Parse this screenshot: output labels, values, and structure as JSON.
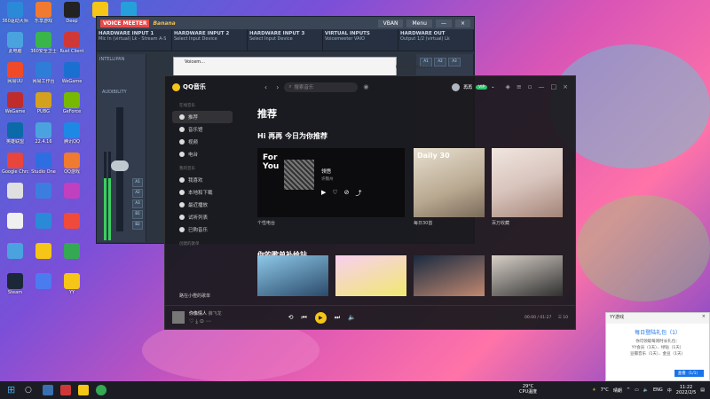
{
  "desktop_icons": [
    {
      "label": "360驱动大师",
      "color": "#2b8ad8"
    },
    {
      "label": "乐享游戏",
      "color": "#f07a30"
    },
    {
      "label": "Deep",
      "color": "#222"
    },
    {
      "label": "",
      "color": "#f5c518"
    },
    {
      "label": "",
      "color": "#26a0da"
    },
    {
      "label": "此电脑",
      "color": "#4aa3df"
    },
    {
      "label": "360安全卫士",
      "color": "#3ab54a"
    },
    {
      "label": "Rust Client",
      "color": "#d03838"
    },
    {
      "label": "网易UU",
      "color": "#f04a28"
    },
    {
      "label": "网易工作台",
      "color": "#2e7dd6"
    },
    {
      "label": "WeGame",
      "color": "#1b6fd0"
    },
    {
      "label": "WeGame",
      "color": "#c02b2b"
    },
    {
      "label": "PUBG",
      "color": "#d4a020"
    },
    {
      "label": "GeForce",
      "color": "#76b900"
    },
    {
      "label": "英雄联盟",
      "color": "#0b6aa8"
    },
    {
      "label": "22.4.16",
      "color": "#4aa3df"
    },
    {
      "label": "腾讯QQ",
      "color": "#1e88e5"
    },
    {
      "label": "Google Chrome",
      "color": "#e8453c"
    },
    {
      "label": "Studio One",
      "color": "#2d6fe0"
    },
    {
      "label": "QQ游戏",
      "color": "#f07a30"
    },
    {
      "label": "",
      "color": "#e0e0e0"
    },
    {
      "label": "",
      "color": "#3b7ee0"
    },
    {
      "label": "",
      "color": "#c040c0"
    },
    {
      "label": "",
      "color": "#f0f0f0"
    },
    {
      "label": "",
      "color": "#2b8ad8"
    },
    {
      "label": "",
      "color": "#f04a3a"
    },
    {
      "label": "",
      "color": "#4aa3df"
    },
    {
      "label": "",
      "color": "#f5c518"
    },
    {
      "label": "",
      "color": "#34a853"
    },
    {
      "label": "Steam",
      "color": "#1b2838"
    },
    {
      "label": "",
      "color": "#4a7cf0"
    },
    {
      "label": "YY",
      "color": "#f5c518"
    }
  ],
  "voicemeeter": {
    "brand": "VOICE MEETER",
    "brand2": "Banana",
    "buttons": [
      "VBAN",
      "Menu"
    ],
    "headers": [
      {
        "title": "HARDWARE INPUT 1",
        "sub": "Mic In (virtual) Lk - Stream A-S"
      },
      {
        "title": "HARDWARE INPUT 2",
        "sub": "Select Input Device"
      },
      {
        "title": "HARDWARE INPUT 3",
        "sub": "Select Input Device"
      },
      {
        "title": "VIRTUAL INPUTS",
        "sub": "Voicemeeter VAIO"
      },
      {
        "title": "HARDWARE OUT",
        "sub": "Output 1/2 (virtual) Lk"
      }
    ],
    "strip_labels": [
      "INTELLIPAN",
      "AUDIBILITY",
      "Fader Gain"
    ]
  },
  "small_window": {
    "title": "Voicem...",
    "right_text": "bie for Playback"
  },
  "qq": {
    "app_name": "QQ音乐",
    "search_placeholder": "搜索音乐",
    "user_name": "再再",
    "vip_label": "VIP",
    "sidebar": {
      "sec_online": "在线音乐",
      "online": [
        {
          "label": "推荐",
          "active": true
        },
        {
          "label": "音乐馆",
          "active": false
        },
        {
          "label": "视频",
          "active": false
        },
        {
          "label": "电台",
          "active": false
        }
      ],
      "sec_mine": "我的音乐",
      "mine": [
        {
          "label": "我喜欢",
          "active": false
        },
        {
          "label": "本地和下载",
          "active": false
        },
        {
          "label": "最近播放",
          "active": false
        },
        {
          "label": "试听列表",
          "active": false
        },
        {
          "label": "已购音乐",
          "active": false
        }
      ],
      "sec_created": "创建的歌单",
      "bottom": "路在小橙的歌单"
    },
    "main": {
      "title": "推荐",
      "greeting": "Hi 再再 今日为你推荐",
      "fm": {
        "title": "For You",
        "song": "领悟",
        "artist": "许魏州",
        "label": "个性电台"
      },
      "daily": {
        "title": "Daily 30",
        "label": "每日30首"
      },
      "hundred": {
        "label": "百万收藏"
      },
      "section2": "你的歌单补给站"
    },
    "player": {
      "song": "你像情人",
      "artist": "薛飞龙",
      "time": "00:00 / 01:27",
      "count": "10"
    }
  },
  "notification": {
    "source": "YY游戏",
    "close": "×",
    "title": "每日登陆礼包（1）",
    "body1": "你可领取每周时长礼包：",
    "body2": "YY会员（1天）、绿钻（1天）",
    "body3": "豆瓣音乐（1天）、金豆（1天）",
    "button": "查看（1/1）"
  },
  "taskbar": {
    "temp": "7°C",
    "weather": "晴朗",
    "cpu_temp": "29°C",
    "cpu_label": "CPU温度",
    "lang": "ENG",
    "time": "11:22",
    "date": "2022/2/5"
  }
}
